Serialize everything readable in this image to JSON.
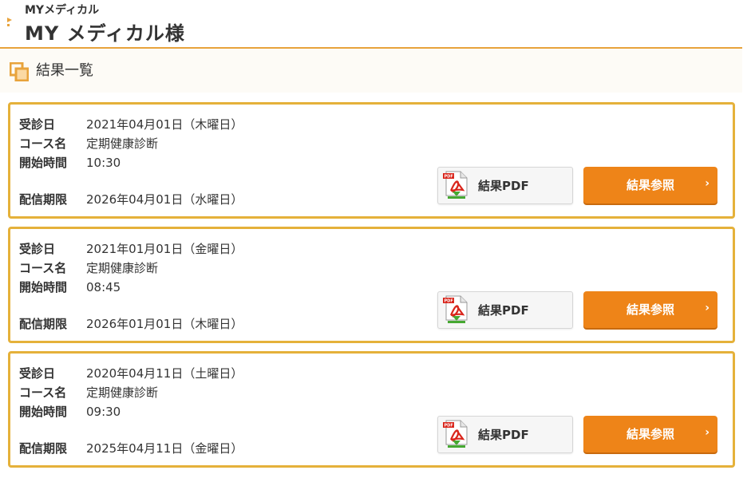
{
  "header": {
    "subtitle": "MYメディカル",
    "title": "MY メディカル様"
  },
  "section": {
    "title": "結果一覧"
  },
  "labels": {
    "exam_date": "受診日",
    "course": "コース名",
    "start_time": "開始時間",
    "deadline": "配信期限",
    "pdf_button": "結果PDF",
    "view_button": "結果参照",
    "chevron": "›"
  },
  "results": [
    {
      "exam_date": "2021年04月01日（木曜日）",
      "course": "定期健康診断",
      "start_time": "10:30",
      "deadline": "2026年04月01日（水曜日）"
    },
    {
      "exam_date": "2021年01月01日（金曜日）",
      "course": "定期健康診断",
      "start_time": "08:45",
      "deadline": "2026年01月01日（木曜日）"
    },
    {
      "exam_date": "2020年04月11日（土曜日）",
      "course": "定期健康診断",
      "start_time": "09:30",
      "deadline": "2025年04月11日（金曜日）"
    }
  ],
  "icons": {
    "back": "back-chevron-icon",
    "section": "overlapping-squares-icon",
    "pdf": "pdf-document-icon"
  },
  "colors": {
    "accent": "#e8a33c",
    "card_border": "#e5b13a",
    "button_orange": "#ee8418",
    "pdf_red": "#d9261c",
    "pdf_green": "#46a832"
  }
}
